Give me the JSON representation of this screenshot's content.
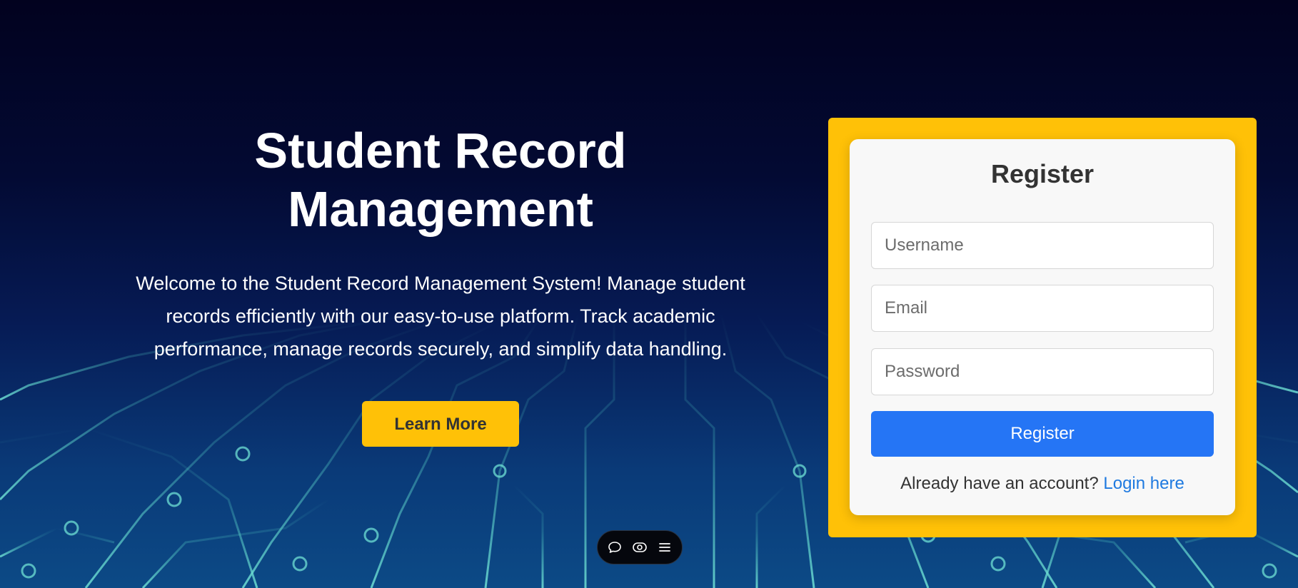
{
  "hero": {
    "title": "Student Record Management",
    "description": "Welcome to the Student Record Management System! Manage student records efficiently with our easy-to-use platform. Track academic performance, manage records securely, and simplify data handling.",
    "learn_more_label": "Learn More"
  },
  "register": {
    "title": "Register",
    "username_placeholder": "Username",
    "email_placeholder": "Email",
    "password_placeholder": "Password",
    "submit_label": "Register",
    "account_prompt": "Already have an account?",
    "login_link": "Login here"
  },
  "toolbar": {
    "icons": [
      "chat-icon",
      "eye-icon",
      "menu-icon"
    ]
  },
  "colors": {
    "accent_yellow": "#ffc107",
    "primary_blue": "#2575f5",
    "link_blue": "#1f7ae0",
    "background_dark": "#02021f"
  }
}
